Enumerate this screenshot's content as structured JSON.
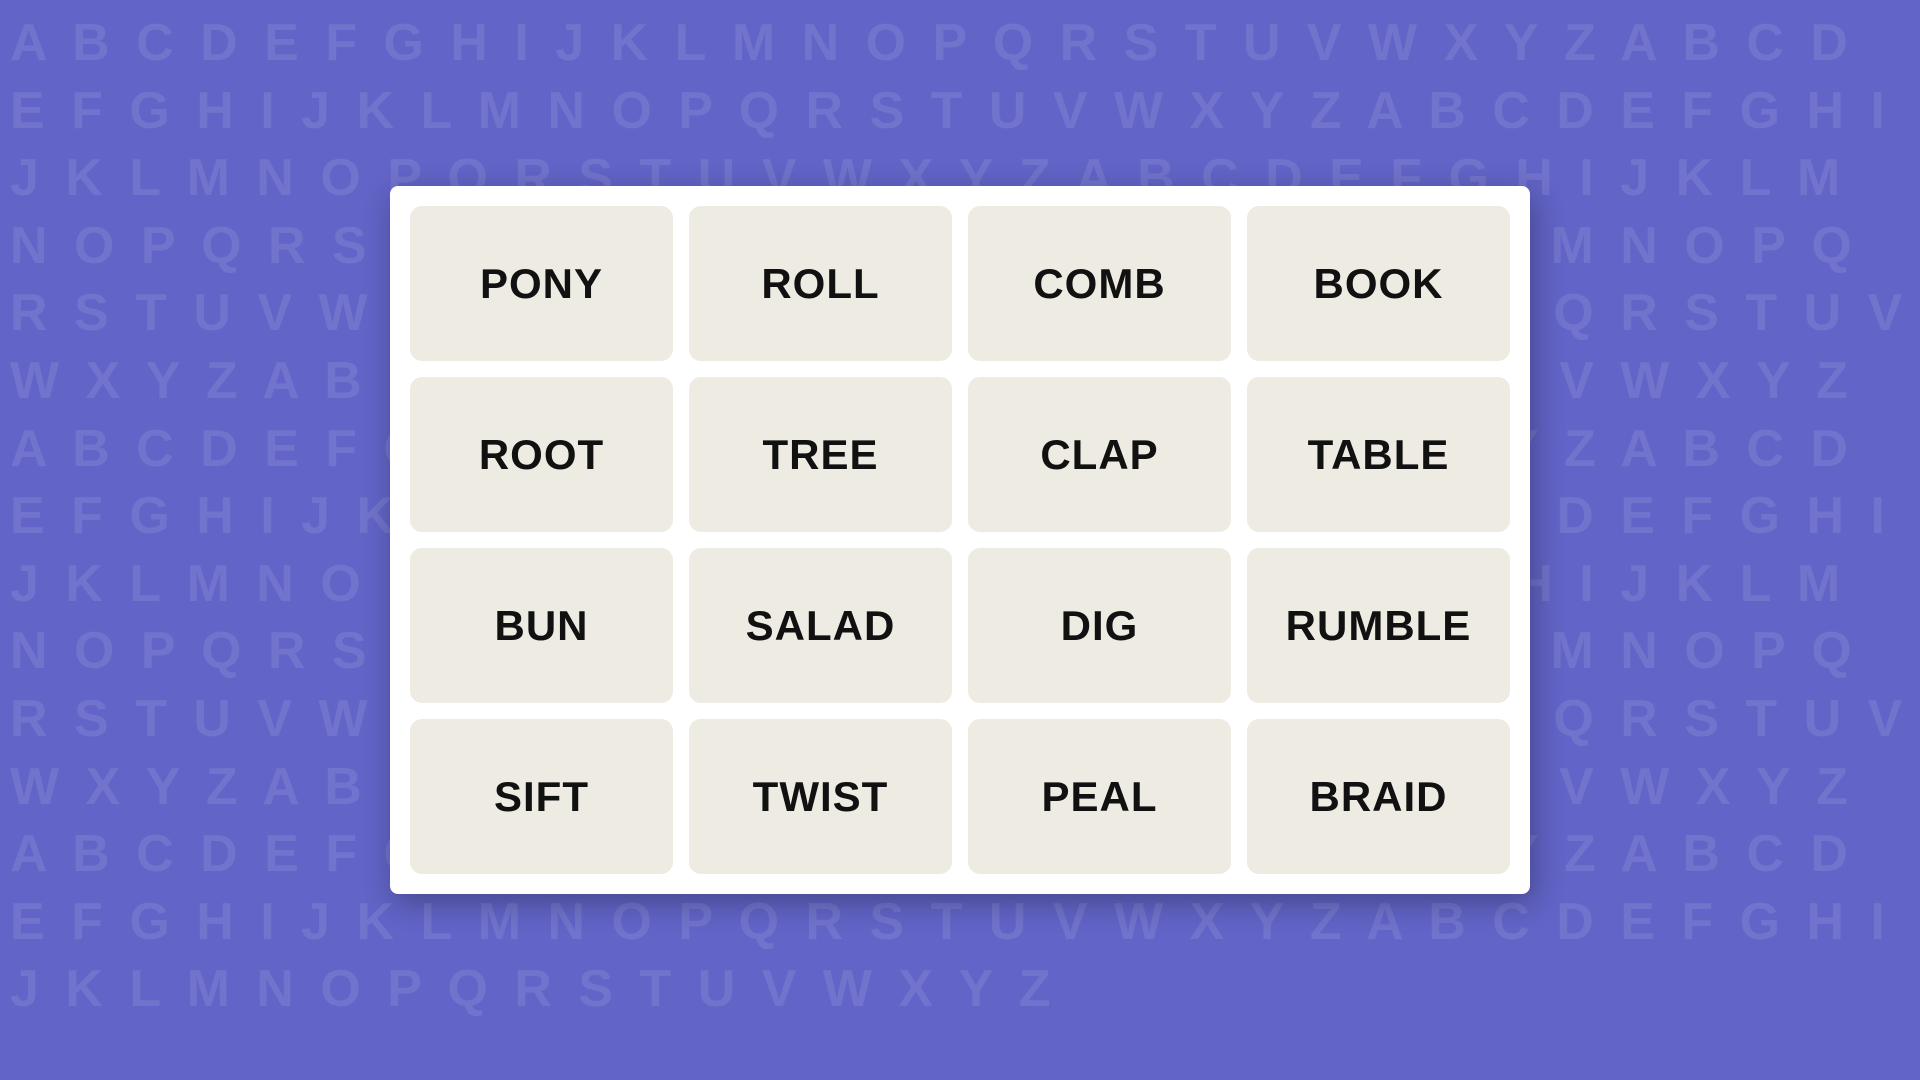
{
  "background": {
    "letters": "A B C D E F G H I J K L M N O P Q R S T U V W X Y Z A B C D E F G H I J K L M N O P Q R S T U V W X Y Z A B C D E F G H I J K L M N O P Q R S T U V W X Y Z A B C D E F G H I J K L M N O P Q R S T U V W X Y Z A B C D E F G H I J K L M N O P Q R S T U V W X Y Z A B C D E F G H I J K L M N O P Q R S T U V W X Y Z A B C D E F G H I J K L M N O P Q R S T U V W X Y Z A B C D E F G H I J K L M N O P Q R S T U V W X Y Z A B C D E F G H I J K L M N O P Q R S T U V W X Y Z A B C D E F G H I J K L M N O P Q R S T U V W X Y Z A B C D E F G H I J K L M N O P Q R S T U V W X Y Z A B C D E F G H I J K L M N O P Q R S T U V W X Y Z A B C D E F G H I J K L M N O P Q R S T U V W X Y Z"
  },
  "grid": {
    "words": [
      "PONY",
      "ROLL",
      "COMB",
      "BOOK",
      "ROOT",
      "TREE",
      "CLAP",
      "TABLE",
      "BUN",
      "SALAD",
      "DIG",
      "RUMBLE",
      "SIFT",
      "TWIST",
      "PEAL",
      "BRAID"
    ]
  }
}
